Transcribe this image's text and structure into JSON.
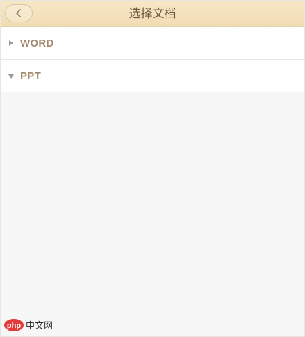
{
  "header": {
    "title": "选择文档",
    "back_icon": "chevron-left-icon"
  },
  "groups": [
    {
      "label": "WORD",
      "expanded": false,
      "icon": "caret-right-icon"
    },
    {
      "label": "PPT",
      "expanded": true,
      "icon": "caret-down-icon"
    }
  ],
  "watermark": {
    "text": "php 中文网"
  },
  "colors": {
    "header_bg": "#f1dcb4",
    "title_text": "#6b5a42",
    "group_text": "#a28a6c",
    "page_bg": "#f7f7f7"
  }
}
